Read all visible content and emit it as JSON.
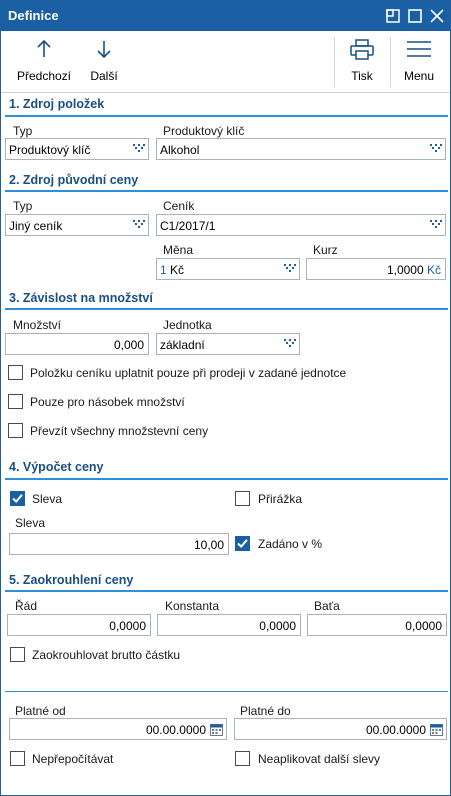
{
  "window": {
    "title": "Definice"
  },
  "toolbar": {
    "prev_label": "Předchozí",
    "next_label": "Další",
    "print_label": "Tisk",
    "menu_label": "Menu"
  },
  "sec1": {
    "title": "1. Zdroj položek",
    "type_label": "Typ",
    "type_value": "Produktový klíč",
    "key_label": "Produktový klíč",
    "key_value": "Alkohol"
  },
  "sec2": {
    "title": "2. Zdroj původní ceny",
    "type_label": "Typ",
    "type_value": "Jiný ceník",
    "pricelist_label": "Ceník",
    "pricelist_value": "C1/2017/1",
    "currency_label": "Měna",
    "currency_prefix": "1",
    "currency_value": "Kč",
    "rate_label": "Kurz",
    "rate_value": "1,0000",
    "rate_unit": "Kč"
  },
  "sec3": {
    "title": "3. Závislost na množství",
    "qty_label": "Množství",
    "qty_value": "0,000",
    "unit_label": "Jednotka",
    "unit_value": "základní",
    "cb1": {
      "label": "Položku ceníku uplatnit pouze při prodeji v zadané jednotce",
      "checked": false
    },
    "cb2": {
      "label": "Pouze pro násobek množství",
      "checked": false
    },
    "cb3": {
      "label": "Převzít všechny množstevní ceny",
      "checked": false
    }
  },
  "sec4": {
    "title": "4. Výpočet ceny",
    "discount_cb": {
      "label": "Sleva",
      "checked": true
    },
    "surcharge_cb": {
      "label": "Přirážka",
      "checked": false
    },
    "discount_label": "Sleva",
    "discount_value": "10,00",
    "percent_cb": {
      "label": "Zadáno v %",
      "checked": true
    }
  },
  "sec5": {
    "title": "5. Zaokrouhlení ceny",
    "order_label": "Řád",
    "order_value": "0,0000",
    "const_label": "Konstanta",
    "const_value": "0,0000",
    "bata_label": "Baťa",
    "bata_value": "0,0000",
    "gross_cb": {
      "label": "Zaokrouhlovat brutto částku",
      "checked": false
    }
  },
  "validity": {
    "from_label": "Platné od",
    "from_value": "00.00.0000",
    "to_label": "Platné do",
    "to_value": "00.00.0000",
    "norecalc_cb": {
      "label": "Nepřepočítávat",
      "checked": false
    },
    "nodiscount_cb": {
      "label": "Neaplikovat další slevy",
      "checked": false
    }
  },
  "colors": {
    "accent": "#1a5fa3",
    "section_line": "#2f8fd8",
    "section_title": "#1a4f86"
  }
}
